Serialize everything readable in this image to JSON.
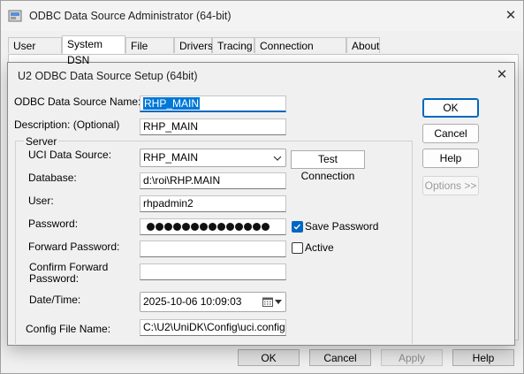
{
  "outer_window": {
    "title": "ODBC Data Source Administrator (64-bit)",
    "close_glyph": "✕",
    "tabs": [
      {
        "label": "User DSN"
      },
      {
        "label": "System DSN"
      },
      {
        "label": "File DSN"
      },
      {
        "label": "Drivers"
      },
      {
        "label": "Tracing"
      },
      {
        "label": "Connection Pooling"
      },
      {
        "label": "About"
      }
    ],
    "active_tab": "System DSN",
    "buttons": {
      "ok": "OK",
      "cancel": "Cancel",
      "apply": "Apply",
      "help": "Help"
    }
  },
  "dialog": {
    "title": "U2 ODBC Data Source Setup (64bit)",
    "close_glyph": "✕",
    "data_source_name": {
      "label": "ODBC Data Source Name:",
      "value": "RHP_MAIN"
    },
    "description": {
      "label": "Description: (Optional)",
      "value": "RHP_MAIN"
    },
    "server_group": {
      "label": "Server",
      "uci_data_source": {
        "label": "UCI Data Source:",
        "value": "RHP_MAIN"
      },
      "test_connection": "Test Connection",
      "database": {
        "label": "Database:",
        "value": "d:\\roi\\RHP.MAIN"
      },
      "user": {
        "label": "User:",
        "value": "rhpadmin2"
      },
      "password": {
        "label": "Password:",
        "masked_length": 14
      },
      "save_password": {
        "label": "Save Password",
        "checked": true
      },
      "forward_password": {
        "label": "Forward Password:",
        "value": ""
      },
      "active": {
        "label": "Active",
        "checked": false
      },
      "confirm_forward_password": {
        "label": "Confirm Forward Password:",
        "value": ""
      },
      "datetime": {
        "label": "Date/Time:",
        "value": "2025-10-06 10:09:03"
      },
      "config_file": {
        "label": "Config File Name:",
        "value": "C:\\U2\\UniDK\\Config\\uci.config"
      }
    },
    "buttons": {
      "ok": "OK",
      "cancel": "Cancel",
      "help": "Help",
      "options": "Options >>"
    }
  },
  "colors": {
    "accent": "#0067c0",
    "selection": "#0078d7",
    "window_bg": "#f0f0f0"
  }
}
